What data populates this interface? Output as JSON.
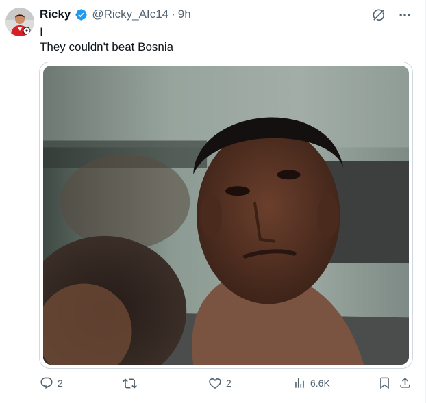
{
  "tweet": {
    "author": {
      "name": "Ricky",
      "handle": "@Ricky_Afc14",
      "separator": "·",
      "time": "9h"
    },
    "text_lines": [
      "I",
      "They couldn't beat Bosnia"
    ],
    "icons": {
      "verified": "verified-badge-icon",
      "grok": "grok-icon",
      "more": "more-options-icon"
    },
    "media": {
      "kind": "photo"
    },
    "actions": {
      "replies": "2",
      "retweets": "",
      "likes": "2",
      "views": "6.6K"
    }
  },
  "colors": {
    "verified_blue": "#1d9bf0",
    "secondary_text": "#536471",
    "primary_text": "#0f1419",
    "border": "#cfd9de"
  }
}
